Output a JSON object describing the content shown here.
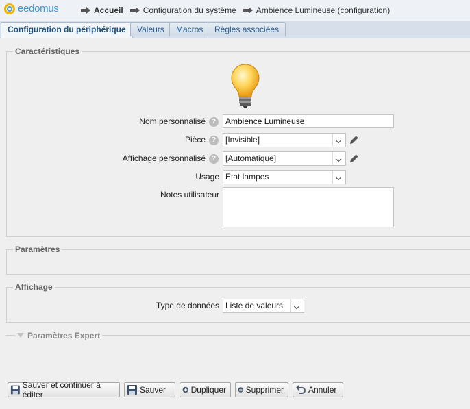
{
  "app": {
    "logo_text": "eedomus"
  },
  "breadcrumb": [
    "Accueil",
    "Configuration du système",
    "Ambience Lumineuse (configuration)"
  ],
  "tabs": [
    "Configuration du périphérique",
    "Valeurs",
    "Macros",
    "Règles associées"
  ],
  "caracteristiques": {
    "legend": "Caractéristiques",
    "nom_label": "Nom personnalisé",
    "nom_value": "Ambience Lumineuse",
    "piece_label": "Pièce",
    "piece_value": "[Invisible]",
    "affichage_label": "Affichage personnalisé",
    "affichage_value": "[Automatique]",
    "usage_label": "Usage",
    "usage_value": "Etat lampes",
    "notes_label": "Notes utilisateur",
    "notes_value": "",
    "help_glyph": "?"
  },
  "parametres": {
    "legend": "Paramètres"
  },
  "affichage": {
    "legend": "Affichage",
    "type_label": "Type de données",
    "type_value": "Liste de valeurs"
  },
  "expert": {
    "legend": "Paramètres Expert"
  },
  "buttons": {
    "save_continue": "Sauver et continuer à éditer",
    "save": "Sauver",
    "duplicate": "Dupliquer",
    "delete": "Supprimer",
    "cancel": "Annuler"
  }
}
